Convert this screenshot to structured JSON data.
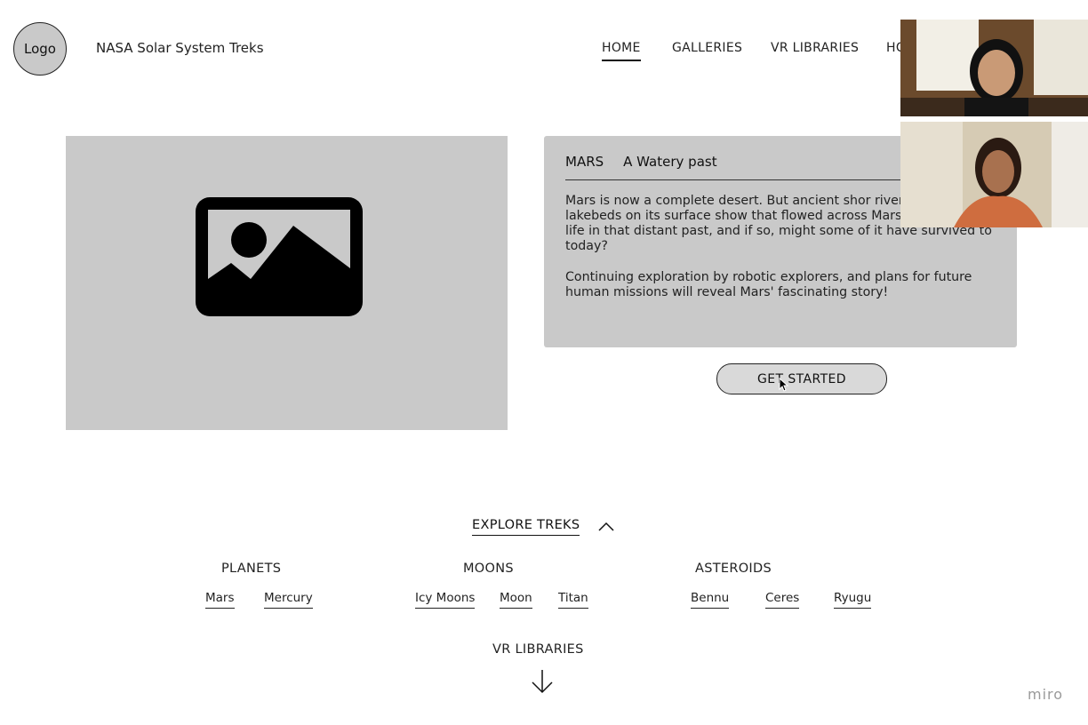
{
  "header": {
    "logo_label": "Logo",
    "site_title": "NASA Solar System Treks",
    "nav": [
      {
        "label": "HOME",
        "active": true
      },
      {
        "label": "GALLERIES",
        "active": false
      },
      {
        "label": "VR LIBRARIES",
        "active": false
      },
      {
        "label": "HC",
        "active": false
      }
    ]
  },
  "hero": {
    "image_icon": "image-placeholder-icon",
    "card": {
      "heading_left": "MARS",
      "heading_right": "A Watery past",
      "paragraphs": [
        "Mars is now a complete desert. But ancient shor riverbeds, and lakebeds on its surface show that flowed across Mars. Did it support life in that distant past, and if so, might some of it have survived to today?",
        "Continuing exploration by robotic explorers, and plans for future human missions will reveal Mars' fascinating story!"
      ]
    },
    "cta_label": "GET STARTED"
  },
  "explore": {
    "title": "EXPLORE TREKS",
    "toggle_icon": "chevron-up-icon",
    "categories": [
      {
        "label": "PLANETS",
        "items": [
          "Mars",
          "Mercury"
        ]
      },
      {
        "label": "MOONS",
        "items": [
          "Icy Moons",
          "Moon",
          "Titan"
        ]
      },
      {
        "label": "ASTEROIDS",
        "items": [
          "Bennu",
          "Ceres",
          "Ryugu"
        ]
      }
    ]
  },
  "vr": {
    "label": "VR LIBRARIES",
    "arrow_icon": "arrow-down-icon"
  },
  "watermark": "miro",
  "colors": {
    "placeholder_gray": "#c9c9c9",
    "button_gray": "#d9d9d9",
    "text": "#222222"
  }
}
